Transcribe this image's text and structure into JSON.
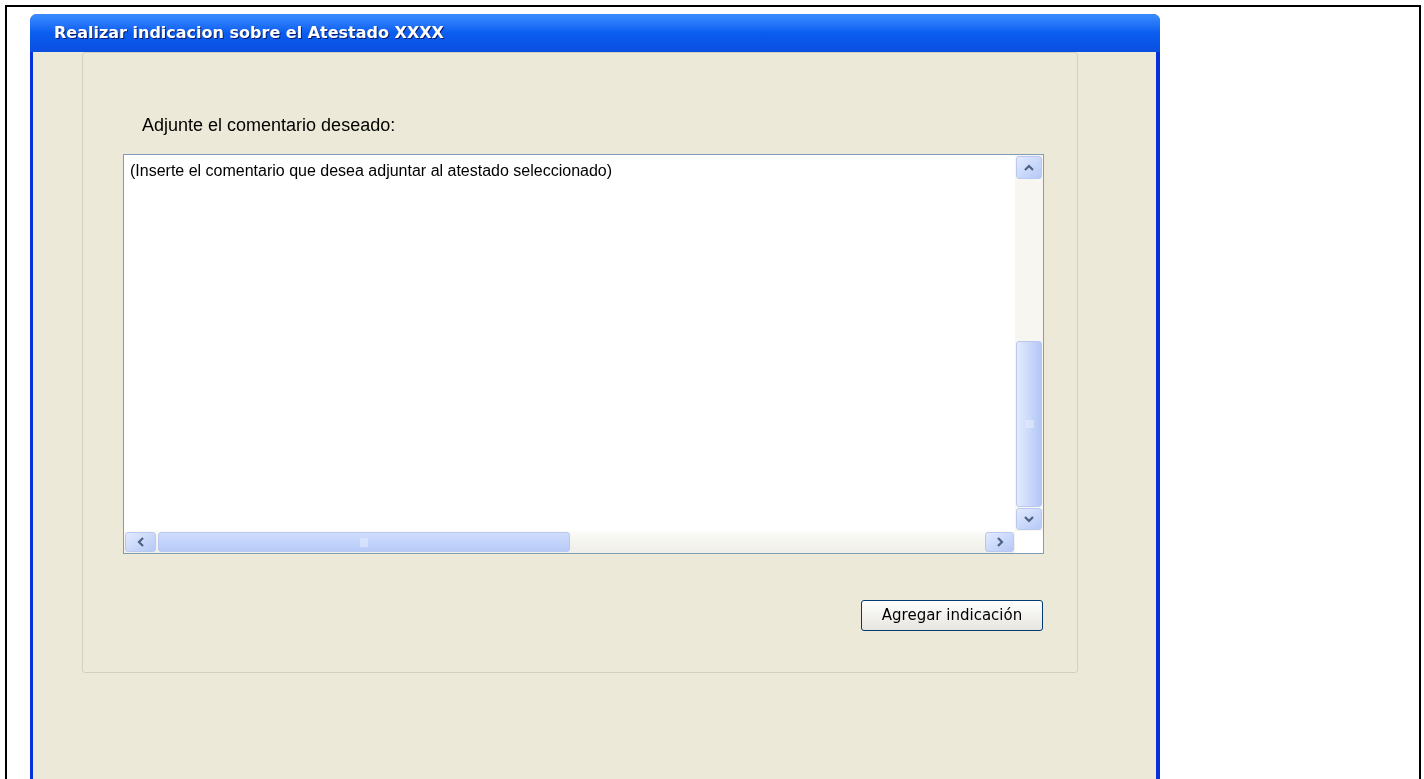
{
  "window": {
    "title": "Realizar indicacion sobre el Atestado XXXX"
  },
  "prompt": "Adjunte el comentario deseado:",
  "comment_field": {
    "value": "(Inserte el comentario que desea adjuntar al atestado seleccionado)"
  },
  "buttons": [
    {
      "label": "Agregar indicación"
    }
  ]
}
